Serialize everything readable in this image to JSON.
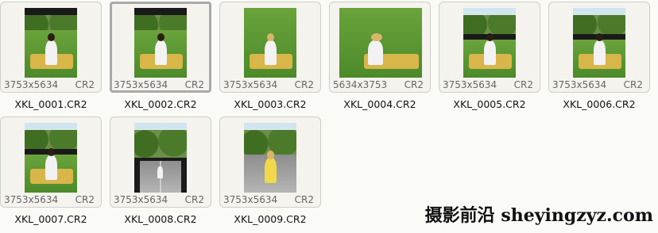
{
  "files": [
    {
      "name": "XKL_0001.CR2",
      "dims": "3753x5634",
      "ext": "CR2",
      "selected": false,
      "orientation": "portrait"
    },
    {
      "name": "XKL_0002.CR2",
      "dims": "3753x5634",
      "ext": "CR2",
      "selected": true,
      "orientation": "portrait"
    },
    {
      "name": "XKL_0003.CR2",
      "dims": "3753x5634",
      "ext": "CR2",
      "selected": false,
      "orientation": "portrait"
    },
    {
      "name": "XKL_0004.CR2",
      "dims": "5634x3753",
      "ext": "CR2",
      "selected": false,
      "orientation": "landscape"
    },
    {
      "name": "XKL_0005.CR2",
      "dims": "3753x5634",
      "ext": "CR2",
      "selected": false,
      "orientation": "portrait"
    },
    {
      "name": "XKL_0006.CR2",
      "dims": "3753x5634",
      "ext": "CR2",
      "selected": false,
      "orientation": "portrait"
    },
    {
      "name": "XKL_0007.CR2",
      "dims": "3753x5634",
      "ext": "CR2",
      "selected": false,
      "orientation": "portrait"
    },
    {
      "name": "XKL_0008.CR2",
      "dims": "3753x5634",
      "ext": "CR2",
      "selected": false,
      "orientation": "portrait"
    },
    {
      "name": "XKL_0009.CR2",
      "dims": "3753x5634",
      "ext": "CR2",
      "selected": false,
      "orientation": "portrait"
    }
  ],
  "watermark": "摄影前沿 sheyingzyz.com",
  "colors": {
    "background": "#fafaf6",
    "card_bg": "#f4f3ee",
    "card_border": "#cfcfc9",
    "selected_border": "#a9a9a9"
  }
}
